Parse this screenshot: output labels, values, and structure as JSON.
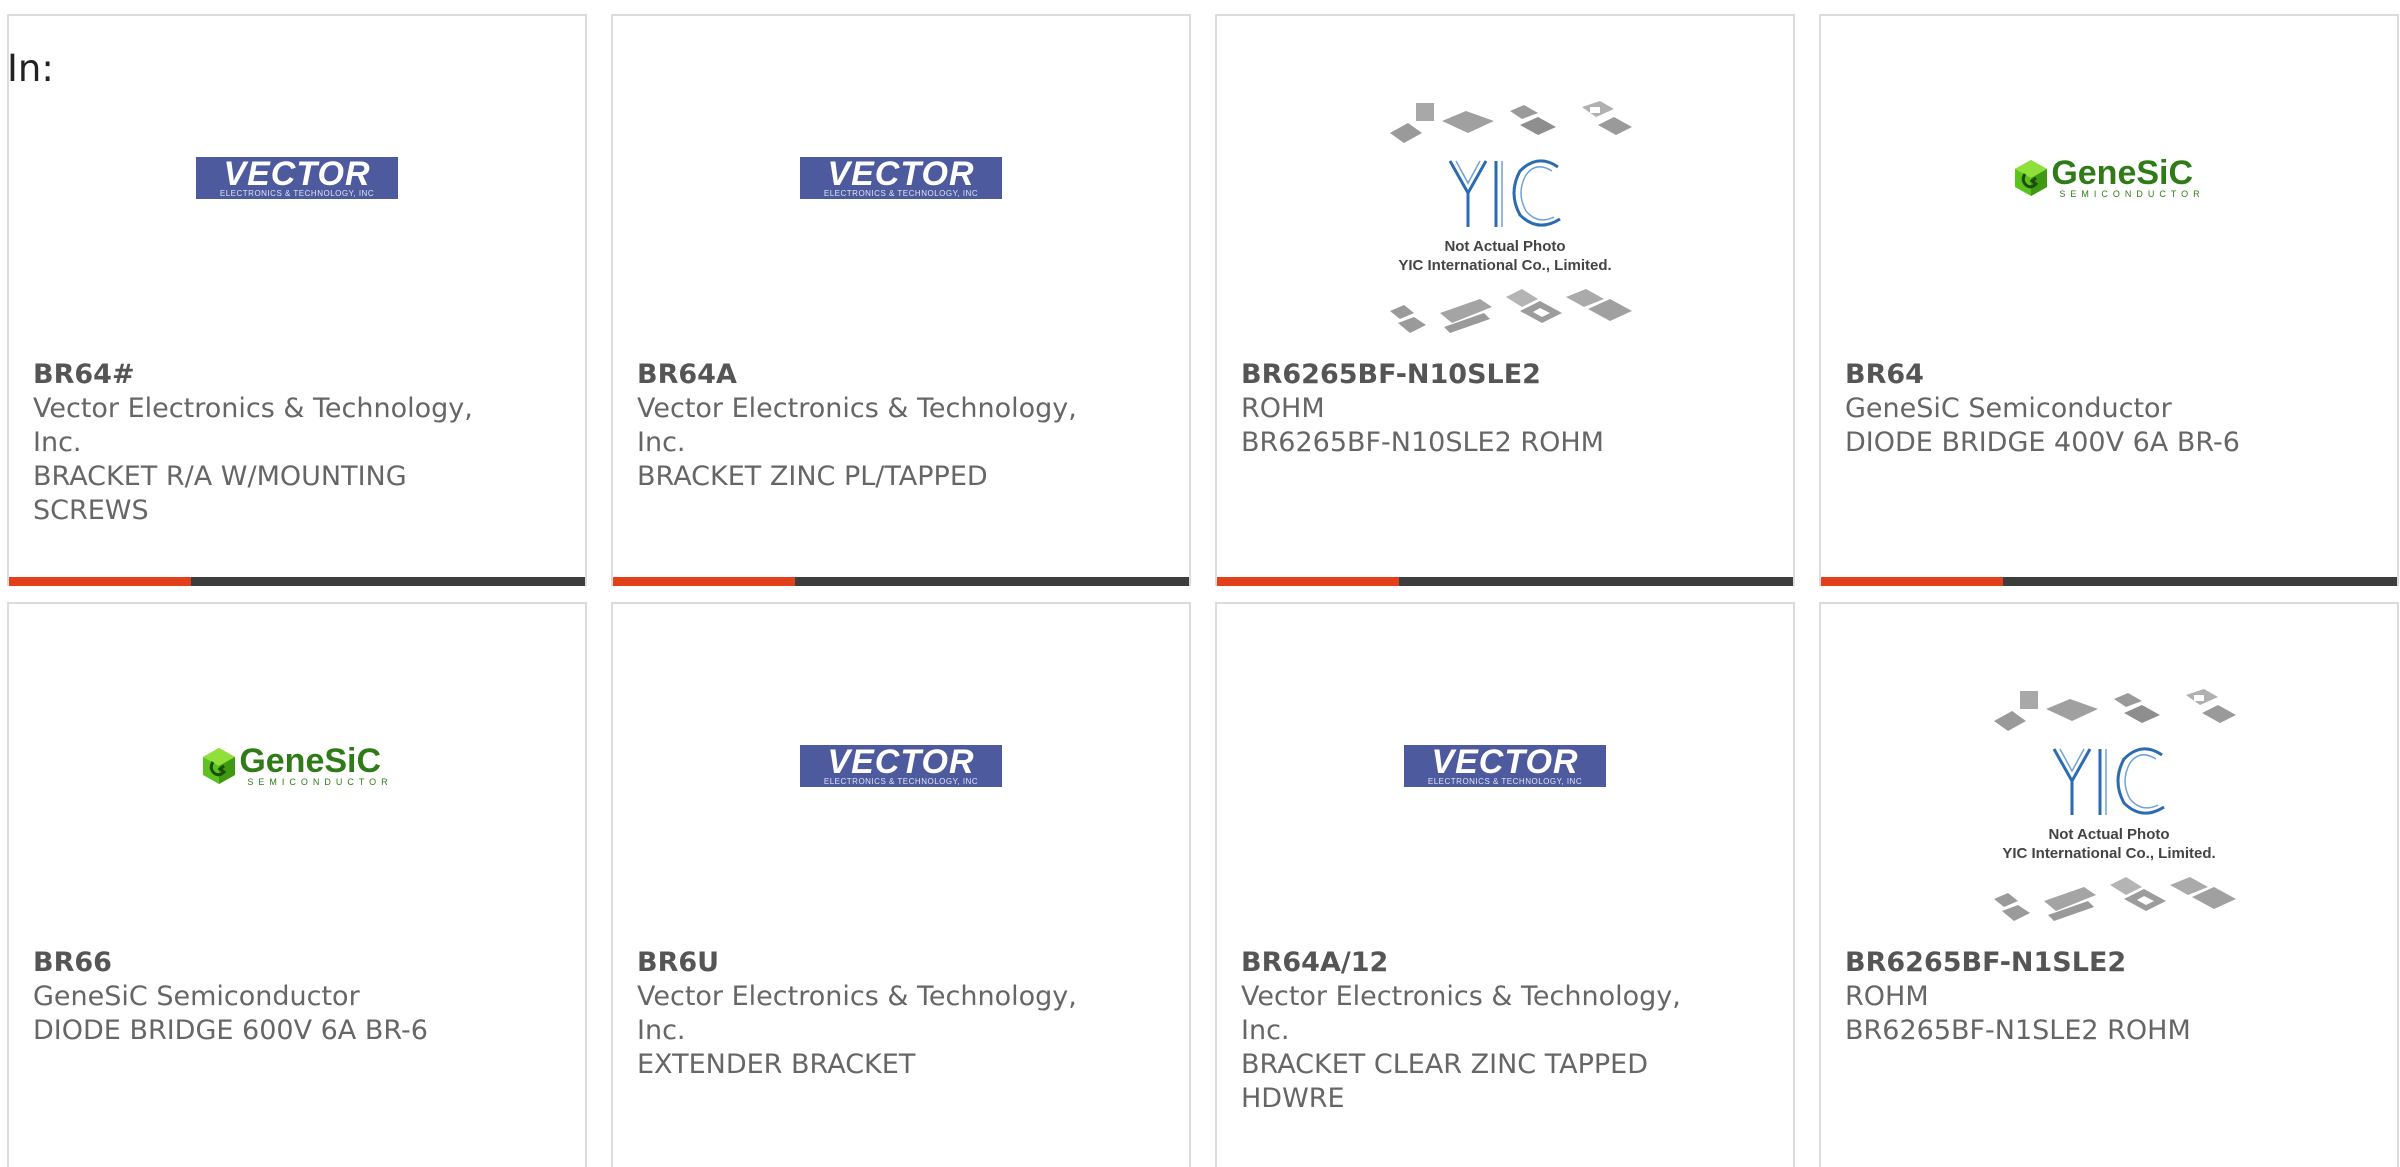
{
  "filter_label": "In:",
  "colors": {
    "accent": "#e2401b",
    "bar": "#3d3d3d",
    "border": "#dcdcdc"
  },
  "products": [
    {
      "part_number": "BR64#",
      "manufacturer": "Vector Electronics & Technology, Inc.",
      "description": "BRACKET R/A W/MOUNTING SCREWS",
      "logo": "vector-logo"
    },
    {
      "part_number": "BR64A",
      "manufacturer": "Vector Electronics & Technology, Inc.",
      "description": "BRACKET ZINC PL/TAPPED",
      "logo": "vector-logo"
    },
    {
      "part_number": "BR6265BF-N10SLE2",
      "manufacturer": "ROHM",
      "description": "BR6265BF-N10SLE2 ROHM",
      "logo": "yic-placeholder"
    },
    {
      "part_number": "BR64",
      "manufacturer": "GeneSiC Semiconductor",
      "description": "DIODE BRIDGE 400V 6A BR-6",
      "logo": "genesic-logo"
    },
    {
      "part_number": "BR66",
      "manufacturer": "GeneSiC Semiconductor",
      "description": "DIODE BRIDGE 600V 6A BR-6",
      "logo": "genesic-logo"
    },
    {
      "part_number": "BR6U",
      "manufacturer": "Vector Electronics & Technology, Inc.",
      "description": "EXTENDER BRACKET",
      "logo": "vector-logo"
    },
    {
      "part_number": "BR64A/12",
      "manufacturer": "Vector Electronics & Technology, Inc.",
      "description": "BRACKET CLEAR ZINC TAPPED HDWRE",
      "logo": "vector-logo"
    },
    {
      "part_number": "BR6265BF-N1SLE2",
      "manufacturer": "ROHM",
      "description": "BR6265BF-N1SLE2 ROHM",
      "logo": "yic-placeholder"
    }
  ],
  "logos": {
    "vector": {
      "wordmark": "VECTOR",
      "tagline": "ELECTRONICS & TECHNOLOGY, INC"
    },
    "genesic": {
      "wordmark": "GeneSiC",
      "tagline": "SEMICONDUCTOR"
    },
    "yic": {
      "mark": "YIC",
      "line1": "Not Actual Photo",
      "line2": "YIC International Co., Limited."
    }
  }
}
